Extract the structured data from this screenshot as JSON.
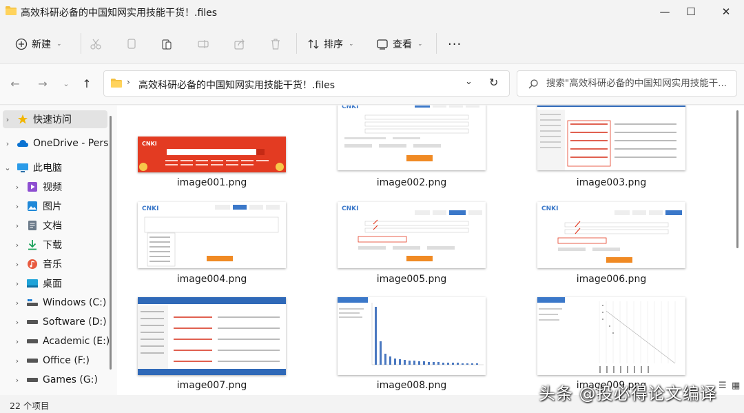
{
  "window": {
    "title": "高效科研必备的中国知网实用技能干货！.files",
    "controls": [
      "—",
      "☐",
      "✕"
    ]
  },
  "toolbar": {
    "new_label": "新建",
    "sort_label": "排序",
    "view_label": "查看",
    "more_label": "···"
  },
  "nav": {
    "address": "高效科研必备的中国知网实用技能干货！.files",
    "search_placeholder": "搜索\"高效科研必备的中国知网实用技能干..."
  },
  "sidebar": {
    "items": [
      {
        "label": "快速访问",
        "icon": "star-icon"
      },
      {
        "label": "OneDrive - Pers",
        "icon": "cloud-icon"
      },
      {
        "label": "此电脑",
        "icon": "computer-icon"
      },
      {
        "label": "视频",
        "icon": "video-icon"
      },
      {
        "label": "图片",
        "icon": "picture-icon"
      },
      {
        "label": "文档",
        "icon": "document-icon"
      },
      {
        "label": "下载",
        "icon": "download-icon"
      },
      {
        "label": "音乐",
        "icon": "music-icon"
      },
      {
        "label": "桌面",
        "icon": "desktop-icon"
      },
      {
        "label": "Windows (C:)",
        "icon": "drive-icon"
      },
      {
        "label": "Software (D:)",
        "icon": "drive-icon"
      },
      {
        "label": "Academic (E:)",
        "icon": "drive-icon"
      },
      {
        "label": "Office (F:)",
        "icon": "drive-icon"
      },
      {
        "label": "Games (G:)",
        "icon": "drive-icon"
      }
    ]
  },
  "files": [
    {
      "name": "image001.png"
    },
    {
      "name": "image002.png"
    },
    {
      "name": "image003.png"
    },
    {
      "name": "image004.png"
    },
    {
      "name": "image005.png"
    },
    {
      "name": "image006.png"
    },
    {
      "name": "image007.png"
    },
    {
      "name": "image008.png"
    },
    {
      "name": "image009.png"
    }
  ],
  "status": {
    "count": "22 个项目"
  },
  "watermark": "头条 @投必得论文编译",
  "colors": {
    "accent": "#0067c0",
    "folder": "#f3c040",
    "cnki_red": "#e33b22",
    "cnki_blue": "#3b78c9",
    "orange_button": "#f08a24"
  }
}
